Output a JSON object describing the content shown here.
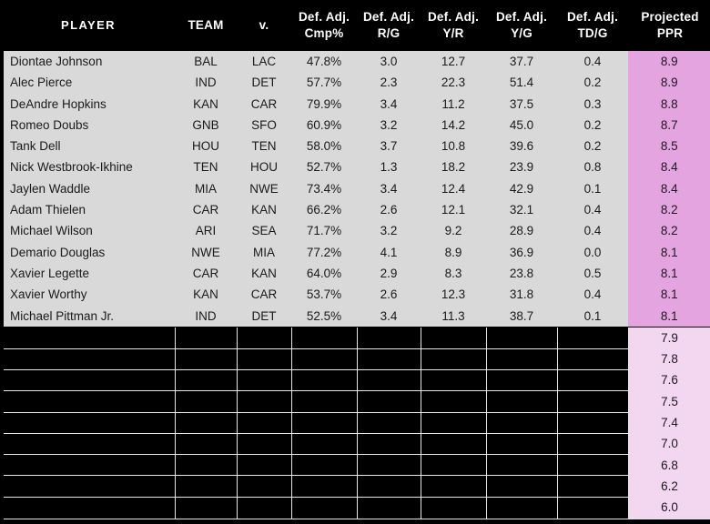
{
  "table": {
    "columns": [
      {
        "key": "player",
        "line1": "PLAYER",
        "line2": "",
        "align": "left"
      },
      {
        "key": "team",
        "line1": "TEAM",
        "line2": "",
        "align": "center"
      },
      {
        "key": "vs",
        "line1": "v.",
        "line2": "",
        "align": "center"
      },
      {
        "key": "cmp",
        "line1": "Def. Adj.",
        "line2": "Cmp%",
        "align": "center"
      },
      {
        "key": "rg",
        "line1": "Def. Adj.",
        "line2": "R/G",
        "align": "center"
      },
      {
        "key": "yr",
        "line1": "Def. Adj.",
        "line2": "Y/R",
        "align": "center"
      },
      {
        "key": "yg",
        "line1": "Def. Adj.",
        "line2": "Y/G",
        "align": "center"
      },
      {
        "key": "tdg",
        "line1": "Def. Adj.",
        "line2": "TD/G",
        "align": "center"
      },
      {
        "key": "ppr",
        "line1": "Projected",
        "line2": "PPR",
        "align": "center"
      }
    ],
    "rows": [
      {
        "player": "Diontae Johnson",
        "team": "BAL",
        "vs": "LAC",
        "cmp": "47.8%",
        "rg": "3.0",
        "yr": "12.7",
        "yg": "37.7",
        "tdg": "0.4",
        "ppr": "8.9"
      },
      {
        "player": "Alec Pierce",
        "team": "IND",
        "vs": "DET",
        "cmp": "57.7%",
        "rg": "2.3",
        "yr": "22.3",
        "yg": "51.4",
        "tdg": "0.2",
        "ppr": "8.9"
      },
      {
        "player": "DeAndre Hopkins",
        "team": "KAN",
        "vs": "CAR",
        "cmp": "79.9%",
        "rg": "3.4",
        "yr": "11.2",
        "yg": "37.5",
        "tdg": "0.3",
        "ppr": "8.8"
      },
      {
        "player": "Romeo Doubs",
        "team": "GNB",
        "vs": "SFO",
        "cmp": "60.9%",
        "rg": "3.2",
        "yr": "14.2",
        "yg": "45.0",
        "tdg": "0.2",
        "ppr": "8.7"
      },
      {
        "player": "Tank Dell",
        "team": "HOU",
        "vs": "TEN",
        "cmp": "58.0%",
        "rg": "3.7",
        "yr": "10.8",
        "yg": "39.6",
        "tdg": "0.2",
        "ppr": "8.5"
      },
      {
        "player": "Nick Westbrook-Ikhine",
        "team": "TEN",
        "vs": "HOU",
        "cmp": "52.7%",
        "rg": "1.3",
        "yr": "18.2",
        "yg": "23.9",
        "tdg": "0.8",
        "ppr": "8.4"
      },
      {
        "player": "Jaylen Waddle",
        "team": "MIA",
        "vs": "NWE",
        "cmp": "73.4%",
        "rg": "3.4",
        "yr": "12.4",
        "yg": "42.9",
        "tdg": "0.1",
        "ppr": "8.4"
      },
      {
        "player": "Adam Thielen",
        "team": "CAR",
        "vs": "KAN",
        "cmp": "66.2%",
        "rg": "2.6",
        "yr": "12.1",
        "yg": "32.1",
        "tdg": "0.4",
        "ppr": "8.2"
      },
      {
        "player": "Michael Wilson",
        "team": "ARI",
        "vs": "SEA",
        "cmp": "71.7%",
        "rg": "3.2",
        "yr": "9.2",
        "yg": "28.9",
        "tdg": "0.4",
        "ppr": "8.2"
      },
      {
        "player": "Demario Douglas",
        "team": "NWE",
        "vs": "MIA",
        "cmp": "77.2%",
        "rg": "4.1",
        "yr": "8.9",
        "yg": "36.9",
        "tdg": "0.0",
        "ppr": "8.1"
      },
      {
        "player": "Xavier Legette",
        "team": "CAR",
        "vs": "KAN",
        "cmp": "64.0%",
        "rg": "2.9",
        "yr": "8.3",
        "yg": "23.8",
        "tdg": "0.5",
        "ppr": "8.1"
      },
      {
        "player": "Xavier Worthy",
        "team": "KAN",
        "vs": "CAR",
        "cmp": "53.7%",
        "rg": "2.6",
        "yr": "12.3",
        "yg": "31.8",
        "tdg": "0.4",
        "ppr": "8.1"
      },
      {
        "player": "Michael Pittman Jr.",
        "team": "IND",
        "vs": "DET",
        "cmp": "52.5%",
        "rg": "3.4",
        "yr": "11.3",
        "yg": "38.7",
        "tdg": "0.1",
        "ppr": "8.1"
      }
    ],
    "hidden_rows": [
      {
        "ppr": "7.9"
      },
      {
        "ppr": "7.8"
      },
      {
        "ppr": "7.6"
      },
      {
        "ppr": "7.5"
      },
      {
        "ppr": "7.4"
      },
      {
        "ppr": "7.0"
      },
      {
        "ppr": "6.8"
      },
      {
        "ppr": "6.2"
      },
      {
        "ppr": "6.0"
      }
    ]
  },
  "colors": {
    "background": "#000000",
    "header_text": "#FFFFFF",
    "cell_background": "#D9D9D9",
    "cell_text": "#1A1A1A",
    "highlight_column": "#E3A4DF",
    "highlight_column_faded": "#F3D6F0",
    "gridline": "#E8E8E8"
  }
}
